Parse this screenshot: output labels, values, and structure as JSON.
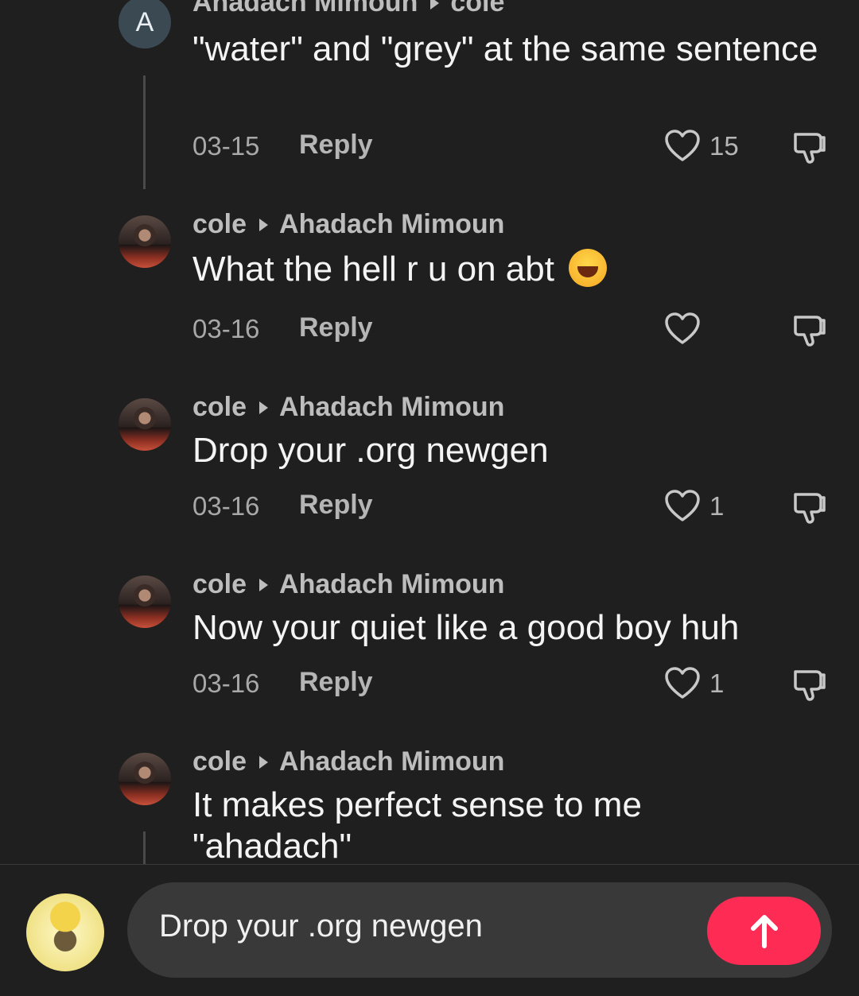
{
  "comments": [
    {
      "author": "Ahadach Mimoun",
      "reply_to": "cole",
      "text": "\"water\" and \"grey\" at the same sentence",
      "date": "03-15",
      "reply_label": "Reply",
      "likes": "15",
      "avatar_letter": "A"
    },
    {
      "author": "cole",
      "reply_to": "Ahadach Mimoun",
      "text": "What the hell r u on abt",
      "date": "03-16",
      "reply_label": "Reply",
      "likes": ""
    },
    {
      "author": "cole",
      "reply_to": "Ahadach Mimoun",
      "text": "Drop your .org newgen",
      "date": "03-16",
      "reply_label": "Reply",
      "likes": "1"
    },
    {
      "author": "cole",
      "reply_to": "Ahadach Mimoun",
      "text": "Now your quiet like a good boy huh",
      "date": "03-16",
      "reply_label": "Reply",
      "likes": "1"
    },
    {
      "author": "cole",
      "reply_to": "Ahadach Mimoun",
      "text": "It makes perfect sense to me \"ahadach\""
    }
  ],
  "composer": {
    "input_value": "Drop your .org newgen",
    "send_icon": "arrow-up-icon",
    "accent_color": "#fe2c55"
  }
}
